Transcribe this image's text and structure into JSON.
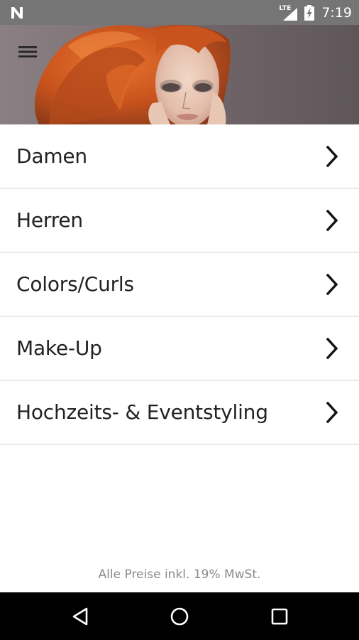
{
  "status_bar": {
    "time": "7:19",
    "network_label": "LTE",
    "icons": [
      "notification-n-icon",
      "lte-signal-icon",
      "battery-charging-icon"
    ]
  },
  "header": {
    "menu_icon": "hamburger-menu-icon",
    "image": "hero-woman-red-hair"
  },
  "menu": {
    "items": [
      {
        "label": "Damen"
      },
      {
        "label": "Herren"
      },
      {
        "label": "Colors/Curls"
      },
      {
        "label": "Make-Up"
      },
      {
        "label": "Hochzeits- & Eventstyling"
      }
    ],
    "chevron_icon": "chevron-right-icon"
  },
  "footer": {
    "note": "Alle Preise inkl. 19% MwSt."
  },
  "nav_bar": {
    "icons": [
      "back-icon",
      "home-icon",
      "recents-icon"
    ]
  },
  "colors": {
    "status_bar": "#757575",
    "text": "#222222",
    "divider": "#cfcfcf",
    "footer_text": "#8a8a8a",
    "nav_bar": "#000000"
  }
}
